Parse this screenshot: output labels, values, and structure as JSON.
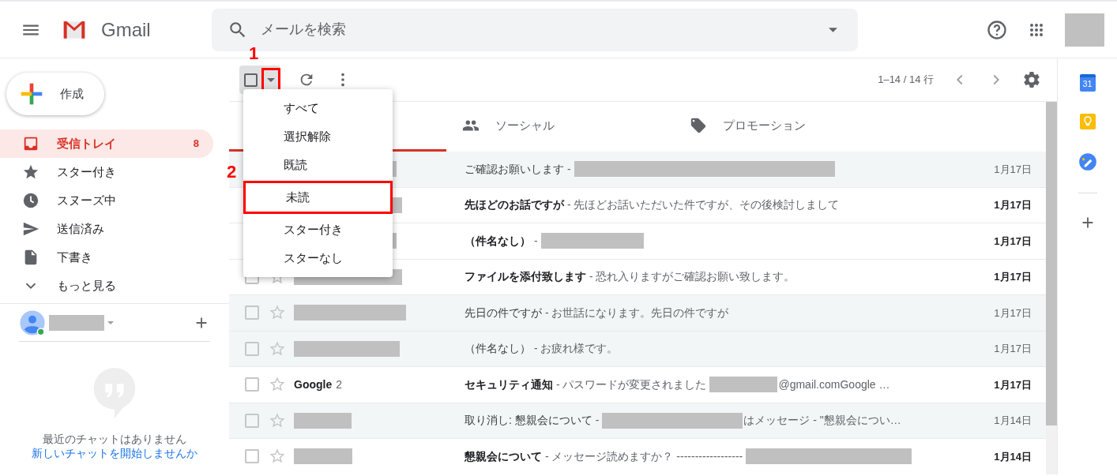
{
  "header": {
    "app_name": "Gmail",
    "search": {
      "placeholder": "メールを検索"
    }
  },
  "compose": {
    "label": "作成"
  },
  "nav": [
    {
      "kind": "inbox",
      "label": "受信トレイ",
      "count": "8",
      "selected": true
    },
    {
      "kind": "star",
      "label": "スター付き",
      "selected": false
    },
    {
      "kind": "clock",
      "label": "スヌーズ中",
      "selected": false
    },
    {
      "kind": "send",
      "label": "送信済み",
      "selected": false
    },
    {
      "kind": "draft",
      "label": "下書き",
      "selected": false
    },
    {
      "kind": "more",
      "label": "もっと見る",
      "selected": false
    }
  ],
  "chat": {
    "empty_text": "最近のチャットはありません",
    "link": "新しいチャットを開始しませんか"
  },
  "toolbar": {
    "page_range": "1–14 / 14 行",
    "select_all_checked": false,
    "select_caret_step": "1"
  },
  "select_menu": {
    "items": [
      {
        "label": "すべて"
      },
      {
        "label": "選択解除"
      },
      {
        "label": "既読"
      },
      {
        "label": "未読",
        "step": "2"
      },
      {
        "label": "スター付き"
      },
      {
        "label": "スターなし"
      }
    ]
  },
  "tabs": [
    {
      "selected": true
    },
    {
      "kind": "social",
      "label": "ソーシャル",
      "selected": false
    },
    {
      "kind": "promotions",
      "label": "プロモーション",
      "selected": false
    }
  ],
  "emails": [
    {
      "unread": false,
      "sender": {
        "kind": "redacted"
      },
      "subject": "ご確認お願いします",
      "snippet": [
        {
          "kind": "text",
          "text": " -"
        },
        {
          "kind": "redacted"
        }
      ],
      "date": "1月17日"
    },
    {
      "unread": true,
      "sender": {
        "kind": "redacted"
      },
      "subject": "先ほどのお話ですが",
      "snippet": [
        {
          "kind": "text",
          "text": " - 先ほどお話いただいた件ですが、その後検討しまして"
        }
      ],
      "date": "1月17日"
    },
    {
      "unread": true,
      "sender": {
        "kind": "redacted"
      },
      "subject": "（件名なし）",
      "snippet": [
        {
          "kind": "text",
          "text": " -"
        },
        {
          "kind": "redacted"
        }
      ],
      "date": "1月17日"
    },
    {
      "unread": true,
      "sender": {
        "kind": "redacted"
      },
      "subject": "ファイルを添付致します",
      "snippet": [
        {
          "kind": "text",
          "text": " - 恐れ入りますがご確認お願い致します。"
        }
      ],
      "date": "1月17日"
    },
    {
      "unread": false,
      "sender": {
        "kind": "redacted"
      },
      "subject": "先日の件ですが",
      "snippet": [
        {
          "kind": "text",
          "text": " - お世話になります。先日の件ですが"
        }
      ],
      "date": "1月17日"
    },
    {
      "unread": false,
      "sender": {
        "kind": "redacted"
      },
      "subject": "（件名なし）",
      "snippet": [
        {
          "kind": "text",
          "text": " - お疲れ様です。"
        }
      ],
      "date": "1月17日"
    },
    {
      "unread": true,
      "sender": {
        "kind": "text",
        "text": "Google",
        "count": "2"
      },
      "subject": "セキュリティ通知",
      "snippet": [
        {
          "kind": "text",
          "text": " - パスワードが変更されました"
        },
        {
          "kind": "redacted"
        },
        {
          "kind": "text",
          "text": "@gmail.comGoogle …"
        }
      ],
      "date": "1月17日"
    },
    {
      "unread": false,
      "sender": {
        "kind": "redacted"
      },
      "subject": "取り消し: 懇親会について",
      "snippet": [
        {
          "kind": "text",
          "text": " -"
        },
        {
          "kind": "redacted"
        },
        {
          "kind": "text",
          "text": "はメッセージ - \"懇親会につい…"
        }
      ],
      "date": "1月14日"
    },
    {
      "unread": true,
      "sender": {
        "kind": "redacted"
      },
      "subject": "懇親会について",
      "snippet": [
        {
          "kind": "text",
          "text": " - メッセージ読めますか？ ------------------"
        },
        {
          "kind": "redacted"
        }
      ],
      "date": "1月14日"
    }
  ],
  "side_panel": {
    "calendar_day": "31"
  }
}
